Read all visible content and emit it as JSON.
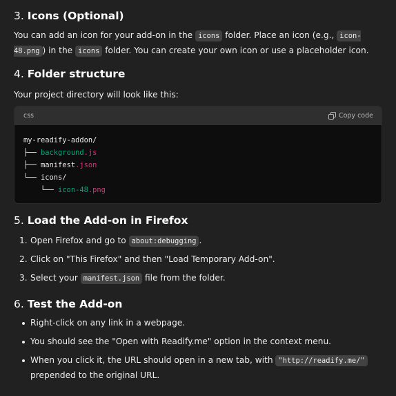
{
  "sec3": {
    "num": "3. ",
    "title": "Icons (Optional)",
    "p_a": "You can add an icon for your add-on in the ",
    "code_icons": "icons",
    "p_b": " folder. Place an icon (e.g., ",
    "code_icon48": "icon-48.png",
    "p_c": ") in the ",
    "p_d": " folder. You can create your own icon or use a placeholder icon."
  },
  "sec4": {
    "num": "4. ",
    "title": "Folder structure",
    "intro": "Your project directory will look like this:",
    "code": {
      "lang": "css",
      "copy_label": "Copy code",
      "line1": "my-readify-addon/",
      "line2_pre": "├── ",
      "line2_a": "background",
      "line2_b": ".js",
      "line3_pre": "├── ",
      "line3_a": "manifest",
      "line3_b": ".json",
      "line4": "└── icons/",
      "line5_pre": "    └── ",
      "line5_a": "icon-48",
      "line5_b": ".png"
    }
  },
  "sec5": {
    "num": "5. ",
    "title": "Load the Add-on in Firefox",
    "items": [
      {
        "marker": "1.",
        "a": "Open Firefox and go to ",
        "code": "about:debugging",
        "b": "."
      },
      {
        "marker": "2.",
        "a": "Click on \"This Firefox\" and then \"Load Temporary Add-on\"."
      },
      {
        "marker": "3.",
        "a": "Select your ",
        "code": "manifest.json",
        "b": " file from the folder."
      }
    ]
  },
  "sec6": {
    "num": "6. ",
    "title": "Test the Add-on",
    "items": [
      {
        "a": "Right-click on any link in a webpage."
      },
      {
        "a": "You should see the \"Open with Readify.me\" option in the context menu."
      },
      {
        "a": "When you click it, the URL should open in a new tab, with ",
        "code": "\"http://readify.me/\"",
        "b": " prepended to the original URL."
      }
    ]
  }
}
